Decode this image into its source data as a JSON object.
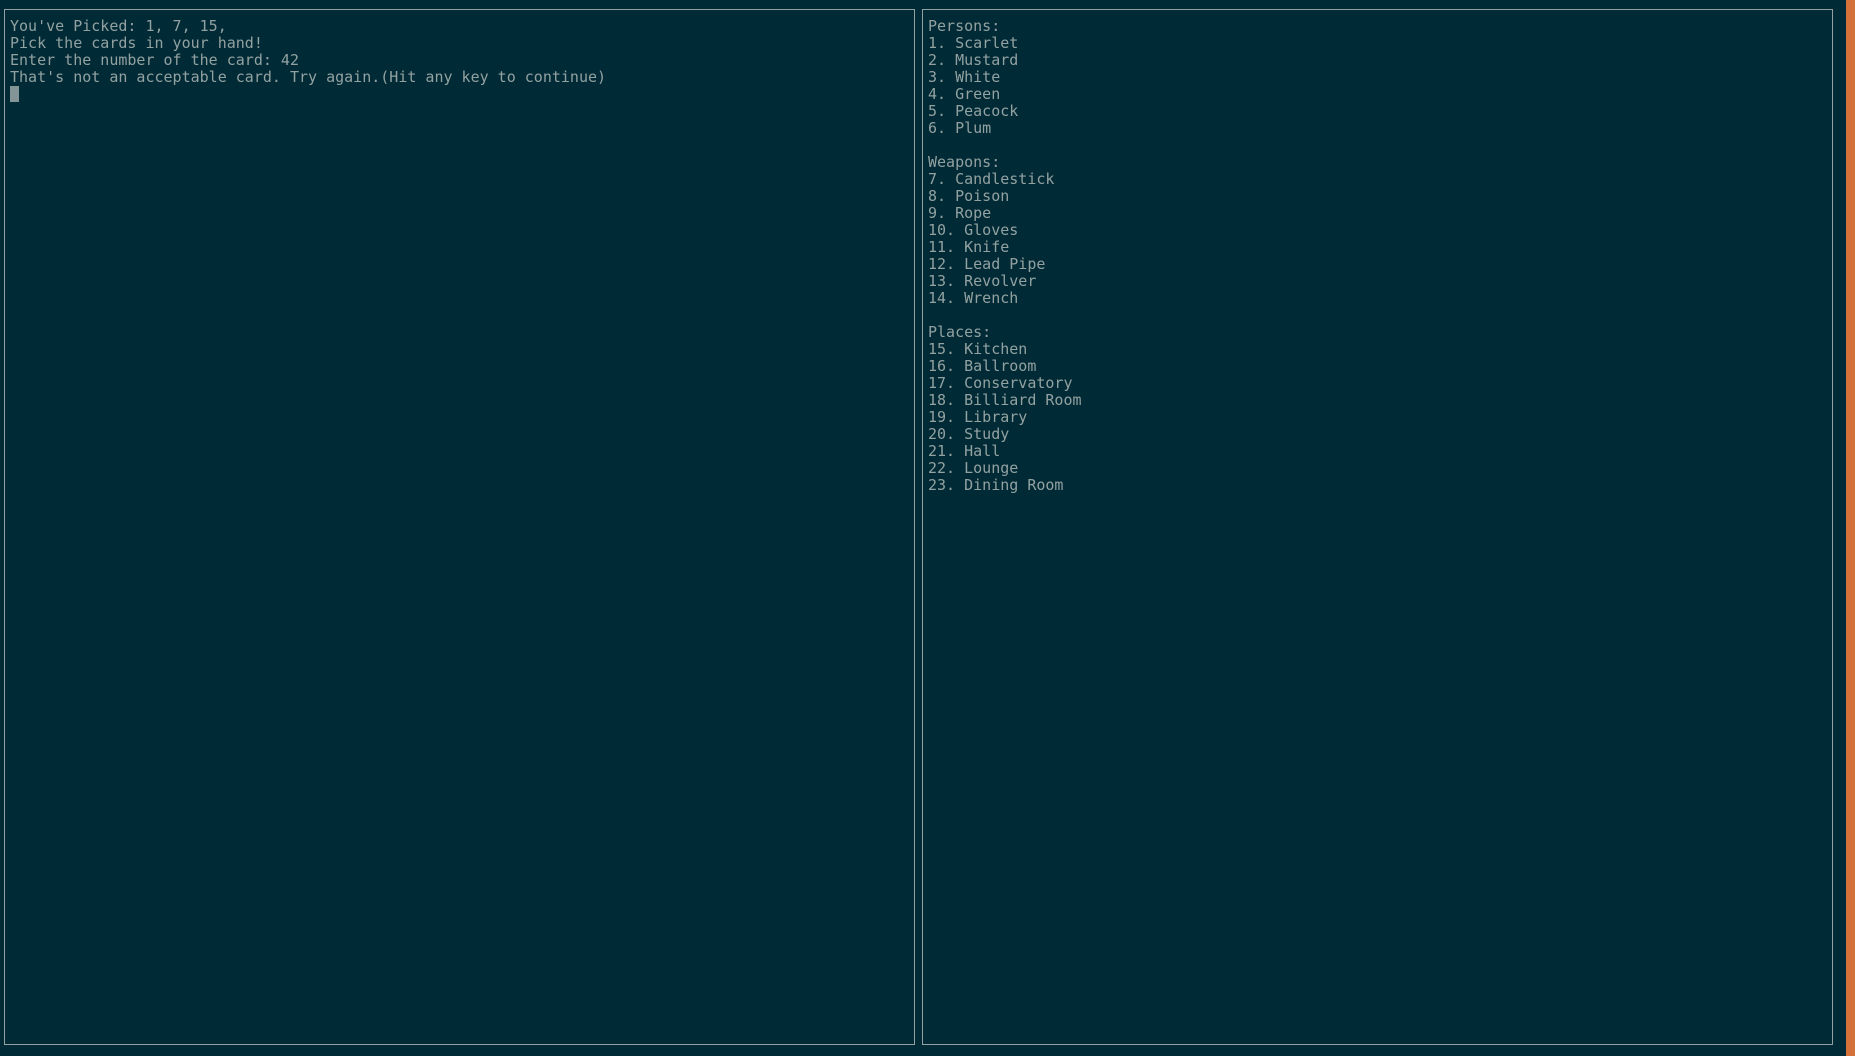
{
  "left_pane": {
    "lines": [
      "You've Picked: 1, 7, 15,",
      "Pick the cards in your hand!",
      "Enter the number of the card: 42",
      "That's not an acceptable card. Try again.(Hit any key to continue)"
    ]
  },
  "right_pane": {
    "persons": {
      "header": "Persons:",
      "items": [
        "1. Scarlet",
        "2. Mustard",
        "3. White",
        "4. Green",
        "5. Peacock",
        "6. Plum"
      ]
    },
    "weapons": {
      "header": "Weapons:",
      "items": [
        "7. Candlestick",
        "8. Poison",
        "9. Rope",
        "10. Gloves",
        "11. Knife",
        "12. Lead Pipe",
        "13. Revolver",
        "14. Wrench"
      ]
    },
    "places": {
      "header": "Places:",
      "items": [
        "15. Kitchen",
        "16. Ballroom",
        "17. Conservatory",
        "18. Billiard Room",
        "19. Library",
        "20. Study",
        "21. Hall",
        "22. Lounge",
        "23. Dining Room"
      ]
    }
  },
  "colors": {
    "background": "#002b36",
    "foreground": "#93a1a1",
    "border": "#93a1a1",
    "cursor": "#839496",
    "edge_accent": "#d4703a"
  }
}
